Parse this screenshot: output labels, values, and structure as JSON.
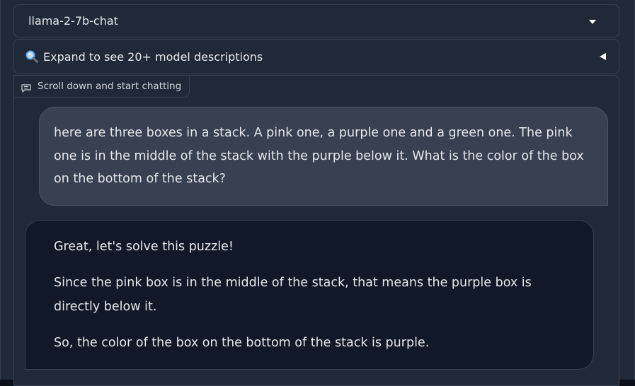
{
  "model_selector": {
    "value": "llama-2-7b-chat"
  },
  "model_descriptions": {
    "icon": "magnifier-icon",
    "label": "Expand to see 20+ model descriptions"
  },
  "chatbot": {
    "tag_icon": "chat-bubble-icon",
    "tag_label": "Scroll down and start chatting",
    "messages": [
      {
        "role": "user",
        "text": "here are three boxes in a stack. A pink one, a purple one and a green one. The pink one is in the middle of the stack with the purple below it. What is the color of the box on the bottom of the stack?"
      },
      {
        "role": "bot",
        "paragraphs": [
          "Great, let's solve this puzzle!",
          "Since the pink box is in the middle of the stack, that means the purple box is directly below it.",
          "So, the color of the box on the bottom of the stack is purple."
        ]
      }
    ]
  },
  "colors": {
    "panel_bg": "#1f2937",
    "border": "#374151",
    "user_bubble": "#374151",
    "bot_bubble": "#111827",
    "text": "#e5e7eb"
  }
}
